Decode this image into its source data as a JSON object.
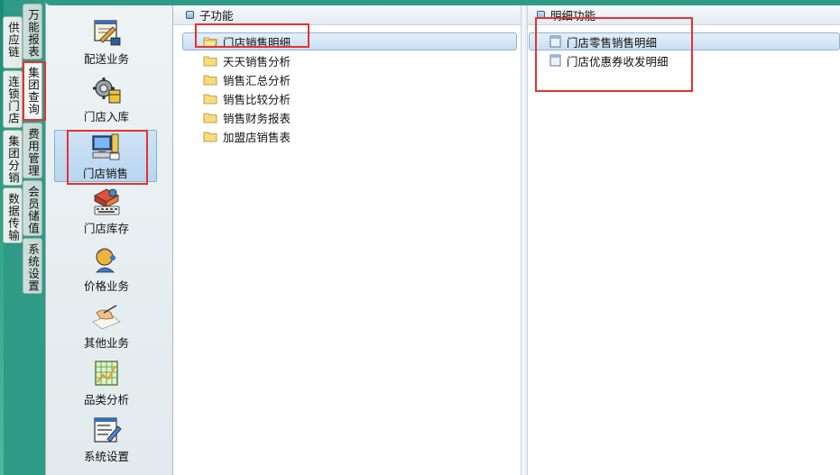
{
  "left_tabs": {
    "col1": [
      {
        "label": "供应链"
      },
      {
        "label": "连锁门店"
      },
      {
        "label": "集团分销"
      },
      {
        "label": "数据传输"
      }
    ],
    "col2": [
      {
        "label": "万能报表"
      },
      {
        "label": "集团查询"
      },
      {
        "label": "费用管理"
      },
      {
        "label": "会员储值"
      },
      {
        "label": "系统设置"
      }
    ]
  },
  "icon_bar": {
    "items": [
      {
        "label": "配送业务",
        "icon": "delivery-icon"
      },
      {
        "label": "门店入库",
        "icon": "gear-warehouse-icon"
      },
      {
        "label": "门店销售",
        "icon": "pos-terminal-icon"
      },
      {
        "label": "门店库存",
        "icon": "inventory-keyboard-icon"
      },
      {
        "label": "价格业务",
        "icon": "person-head-icon"
      },
      {
        "label": "其他业务",
        "icon": "hand-writing-icon"
      },
      {
        "label": "品类分析",
        "icon": "category-chart-icon"
      },
      {
        "label": "系统设置",
        "icon": "settings-form-icon"
      }
    ],
    "selected": "门店销售"
  },
  "sub_functions": {
    "title": "子功能",
    "items": [
      {
        "label": "门店销售明细",
        "selected": true
      },
      {
        "label": "天天销售分析"
      },
      {
        "label": "销售汇总分析"
      },
      {
        "label": "销售比较分析"
      },
      {
        "label": "销售财务报表"
      },
      {
        "label": "加盟店销售表"
      }
    ]
  },
  "detail_functions": {
    "title": "明细功能",
    "items": [
      {
        "label": "门店零售销售明细",
        "selected": true
      },
      {
        "label": "门店优惠券收发明细"
      }
    ]
  },
  "colors": {
    "background_green": "#2f9a86",
    "selection_blue": "#c9ddf1",
    "annotation_red": "#e5322e"
  }
}
